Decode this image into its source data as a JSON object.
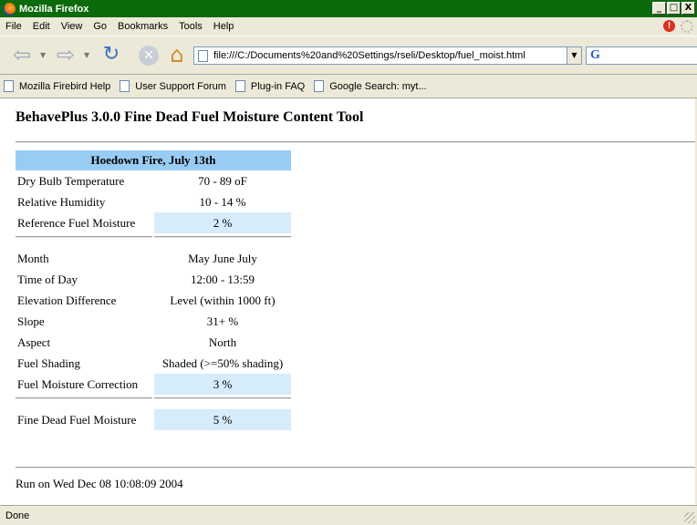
{
  "window": {
    "title": "Mozilla Firefox",
    "controls": {
      "minimize": "_",
      "maximize": "□",
      "close": "X"
    }
  },
  "menu": {
    "items": [
      {
        "label": "File"
      },
      {
        "label": "Edit"
      },
      {
        "label": "View"
      },
      {
        "label": "Go"
      },
      {
        "label": "Bookmarks"
      },
      {
        "label": "Tools"
      },
      {
        "label": "Help"
      }
    ]
  },
  "toolbar": {
    "url": "file:///C:/Documents%20and%20Settings/rseli/Desktop/fuel_moist.html",
    "search_value": ""
  },
  "bookmarks": [
    {
      "label": "Mozilla Firebird Help"
    },
    {
      "label": "User Support Forum"
    },
    {
      "label": "Plug-in FAQ"
    },
    {
      "label": "Google Search: myt..."
    }
  ],
  "page": {
    "title": "BehavePlus 3.0.0 Fine Dead Fuel Moisture Content Tool",
    "fire_name": "Hoedown Fire, July 13th",
    "rows": {
      "dry_bulb": {
        "label": "Dry Bulb Temperature",
        "value": "70 - 89 oF"
      },
      "rh": {
        "label": "Relative Humidity",
        "value": "10 - 14 %"
      },
      "ref_moisture": {
        "label": "Reference Fuel Moisture",
        "value": "2 %"
      },
      "month": {
        "label": "Month",
        "value": "May June July"
      },
      "time": {
        "label": "Time of Day",
        "value": "12:00 - 13:59"
      },
      "elevation": {
        "label": "Elevation Difference",
        "value": "Level (within 1000 ft)"
      },
      "slope": {
        "label": "Slope",
        "value": "31+ %"
      },
      "aspect": {
        "label": "Aspect",
        "value": "North"
      },
      "shading": {
        "label": "Fuel Shading",
        "value": "Shaded (>=50% shading)"
      },
      "correction": {
        "label": "Fuel Moisture Correction",
        "value": "3 %"
      },
      "fine_dead": {
        "label": "Fine Dead Fuel Moisture",
        "value": "5 %"
      }
    },
    "run_info": "Run on Wed Dec 08 10:08:09 2004"
  },
  "status": {
    "text": "Done"
  },
  "colors": {
    "title_bar": "#0b6a0b",
    "table_header": "#99ccf3",
    "highlight_cell": "#d6ecfb"
  }
}
